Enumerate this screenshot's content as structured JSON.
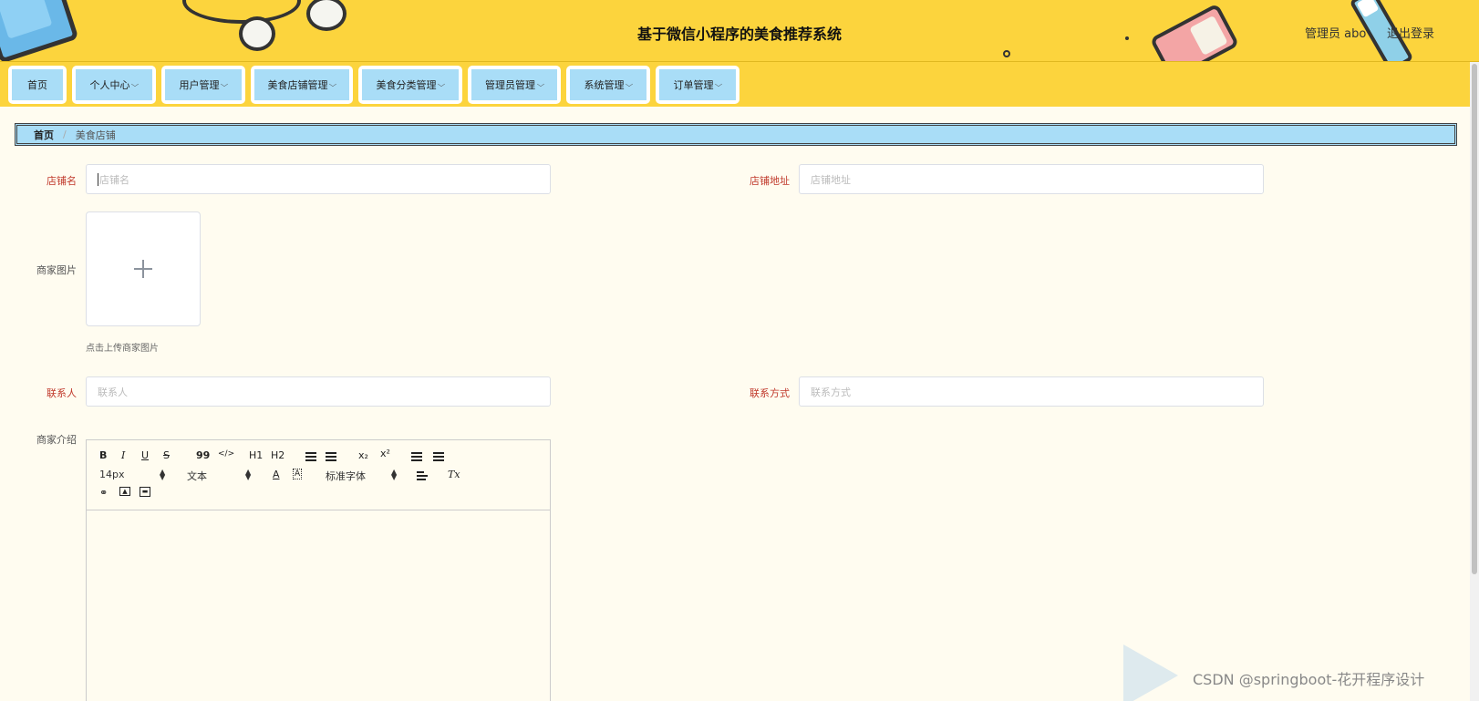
{
  "header": {
    "title": "基于微信小程序的美食推荐系统",
    "admin_label": "管理员 abo",
    "logout_label": "退出登录"
  },
  "nav": {
    "items": [
      {
        "label": "首页",
        "has_dropdown": false
      },
      {
        "label": "个人中心",
        "has_dropdown": true
      },
      {
        "label": "用户管理",
        "has_dropdown": true
      },
      {
        "label": "美食店铺管理",
        "has_dropdown": true
      },
      {
        "label": "美食分类管理",
        "has_dropdown": true
      },
      {
        "label": "管理员管理",
        "has_dropdown": true
      },
      {
        "label": "系统管理",
        "has_dropdown": true
      },
      {
        "label": "订单管理",
        "has_dropdown": true
      }
    ]
  },
  "breadcrumb": {
    "home": "首页",
    "separator": "/",
    "current": "美食店铺"
  },
  "form": {
    "shop_name": {
      "label": "店铺名",
      "placeholder": "店铺名",
      "value": ""
    },
    "shop_address": {
      "label": "店铺地址",
      "placeholder": "店铺地址",
      "value": ""
    },
    "shop_image": {
      "label": "商家图片",
      "hint": "点击上传商家图片"
    },
    "contact_person": {
      "label": "联系人",
      "placeholder": "联系人",
      "value": ""
    },
    "contact_method": {
      "label": "联系方式",
      "placeholder": "联系方式",
      "value": ""
    },
    "shop_intro": {
      "label": "商家介绍"
    }
  },
  "editor": {
    "buttons": {
      "bold": "B",
      "italic": "I",
      "underline": "U",
      "strike": "S",
      "blockquote": "99",
      "code": "</>",
      "h1": "H1",
      "h2": "H2",
      "subscript": "x₂",
      "superscript": "x²",
      "clean": "Tx"
    },
    "font_size": "14px",
    "header_select": "文本",
    "font_family": "标准字体"
  },
  "watermark": {
    "csdn": "CSDN @springboot-花开程序设计"
  },
  "colors": {
    "header_bg": "#fcd43d",
    "nav_item_bg": "#a9ddf7",
    "page_bg": "#fffcf0",
    "required_label": "#c0392b"
  }
}
